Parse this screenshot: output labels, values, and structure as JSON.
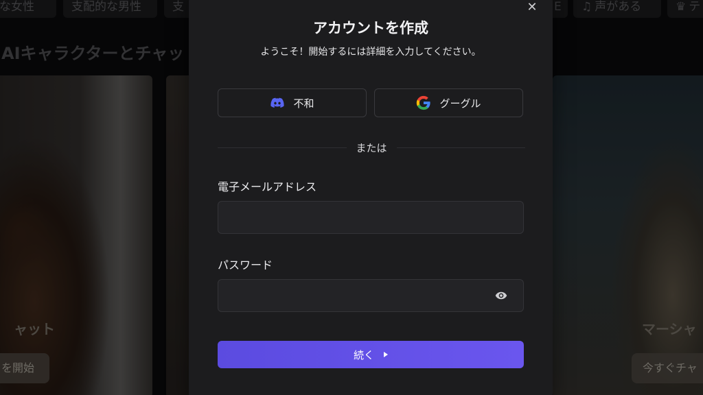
{
  "background": {
    "tags": [
      {
        "label": "〜な女性"
      },
      {
        "label": "支配的な男性"
      },
      {
        "label": "支"
      },
      {
        "label": "E"
      },
      {
        "label": "声がある"
      },
      {
        "label": "テ"
      }
    ],
    "section_title": "AIキャラクターとチャッ",
    "cards": {
      "left_caption": "ャット",
      "left_button": "を開始",
      "right_caption": "マーシャ",
      "right_button": "今すぐチャ"
    }
  },
  "modal": {
    "title": "アカウントを作成",
    "subtitle": "ようこそ！開始するには詳細を入力してください。",
    "close_icon": "close-icon",
    "social": {
      "discord_label": "不和",
      "discord_icon": "discord-icon",
      "discord_color": "#5865F2",
      "google_label": "グーグル",
      "google_icon": "google-icon"
    },
    "divider_text": "または",
    "email": {
      "label": "電子メールアドレス",
      "value": "",
      "placeholder": ""
    },
    "password": {
      "label": "パスワード",
      "value": "",
      "placeholder": "",
      "toggle_icon": "eye-icon"
    },
    "continue_label": "続く",
    "accent_color": "#6153E8"
  }
}
